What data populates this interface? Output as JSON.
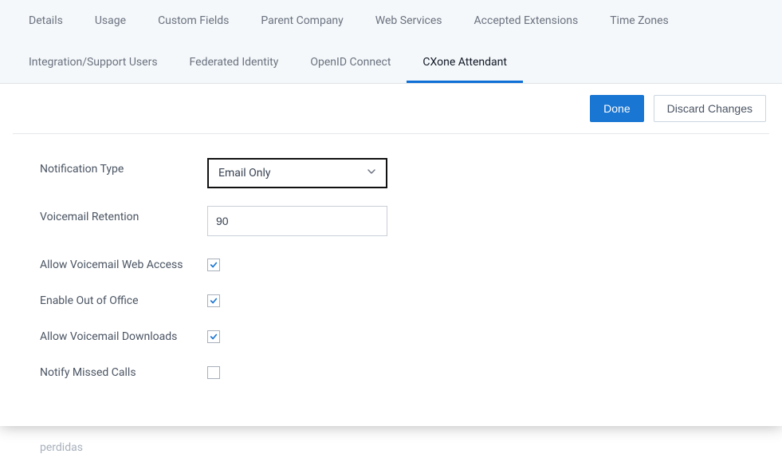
{
  "tabs": [
    {
      "label": "Details"
    },
    {
      "label": "Usage"
    },
    {
      "label": "Custom Fields"
    },
    {
      "label": "Parent Company"
    },
    {
      "label": "Web Services"
    },
    {
      "label": "Accepted Extensions"
    },
    {
      "label": "Time Zones"
    },
    {
      "label": "Integration/Support Users"
    },
    {
      "label": "Federated Identity"
    },
    {
      "label": "OpenID Connect"
    },
    {
      "label": "CXone Attendant",
      "active": true
    }
  ],
  "actions": {
    "done": "Done",
    "discard": "Discard Changes"
  },
  "form": {
    "notification_type": {
      "label": "Notification Type",
      "value": "Email Only"
    },
    "voicemail_retention": {
      "label": "Voicemail Retention",
      "value": "90"
    },
    "allow_web_access": {
      "label": "Allow Voicemail Web Access",
      "checked": true
    },
    "enable_ooo": {
      "label": "Enable Out of Office",
      "checked": true
    },
    "allow_downloads": {
      "label": "Allow Voicemail Downloads",
      "checked": true
    },
    "notify_missed": {
      "label": "Notify Missed Calls",
      "checked": false
    }
  },
  "ghost": "perdidas"
}
